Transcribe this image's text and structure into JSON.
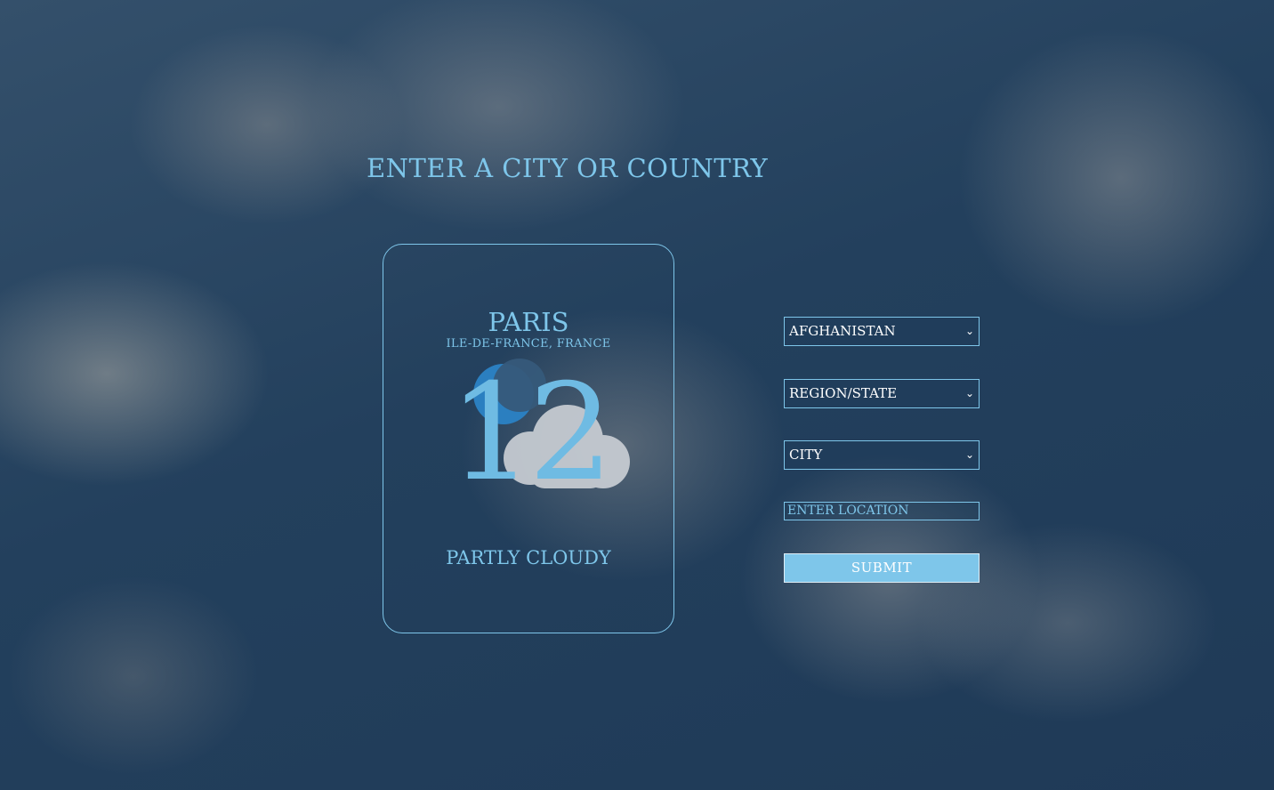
{
  "page": {
    "heading": "ENTER A CITY OR COUNTRY"
  },
  "weather_card": {
    "city": "PARIS",
    "region": "ILE-DE-FRANCE, FRANCE",
    "temperature": "12",
    "condition": "PARTLY CLOUDY",
    "icon": "partly-cloudy-night-icon"
  },
  "form": {
    "country_select": {
      "selected": "AFGHANISTAN"
    },
    "region_select": {
      "selected": "REGION/STATE"
    },
    "city_select": {
      "selected": "CITY"
    },
    "location_input": {
      "value": "",
      "placeholder": "ENTER LOCATION"
    },
    "submit_label": "SUBMIT"
  },
  "colors": {
    "accent": "#7ec6ea",
    "background": "#2a4562"
  }
}
